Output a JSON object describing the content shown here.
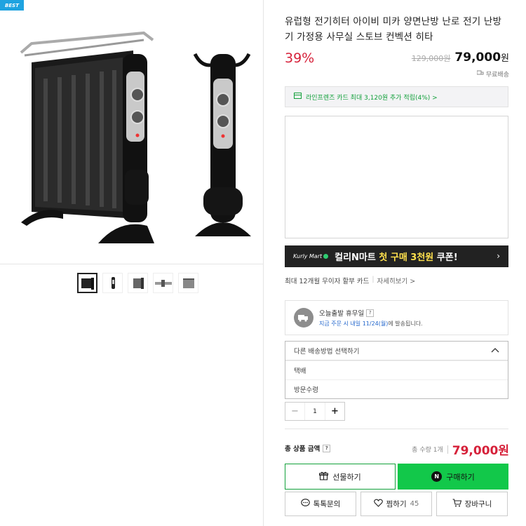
{
  "badge": "BEST",
  "product": {
    "title": "유럽형 전기히터 아이비 미카 양면난방 난로 전기 난방기 가정용 사무실 스토브 컨벡션 히타",
    "discount": "39%",
    "original_price": "129,000원",
    "sale_price": "79,000",
    "currency": "원",
    "shipping": "무료배송"
  },
  "card_benefit": "라인프렌즈 카드 최대 3,120원 추가 적립(4%) >",
  "kurly": {
    "logo": "Kurly Mart",
    "text_a": "컬리N마트 ",
    "text_b": "첫 구매 3천원",
    "text_c": " 쿠폰!",
    "arrow": "›"
  },
  "installment": {
    "text": "최대 12개월 무이자 할부 카드",
    "sep": "|",
    "link": "자세히보기 >"
  },
  "delivery": {
    "title": "오늘출발 휴무일",
    "q": "?",
    "sub_prefix": "지금 주문 시 내일 11/24(월)",
    "sub_suffix": "에 발송됩니다."
  },
  "shipping_select": {
    "placeholder": "다른 배송방법 선택하기",
    "options": [
      "택배",
      "방문수령"
    ]
  },
  "quantity": {
    "minus": "−",
    "value": "1",
    "plus": "+"
  },
  "total": {
    "label": "총 상품 금액",
    "q": "?",
    "qty": "총 수량 1개",
    "price": "79,000원"
  },
  "buttons": {
    "gift": "선물하기",
    "buy": "구매하기",
    "n": "N",
    "inquiry": "톡톡문의",
    "wish": "찜하기",
    "wish_count": "45",
    "cart": "장바구니"
  },
  "colors": {
    "accent_red": "#d6213a",
    "naver_green": "#12c84a",
    "badge_blue": "#1fa3e0"
  }
}
